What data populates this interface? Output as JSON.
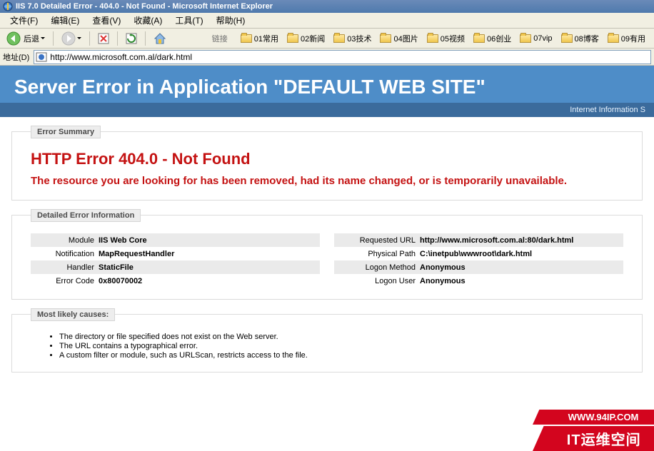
{
  "titlebar": {
    "text": "IIS 7.0 Detailed Error - 404.0 - Not Found - Microsoft Internet Explorer"
  },
  "menu": {
    "file": "文件(F)",
    "edit": "编辑(E)",
    "view": "查看(V)",
    "favorites": "收藏(A)",
    "tools": "工具(T)",
    "help": "帮助(H)"
  },
  "toolbar": {
    "back": "后退"
  },
  "linksbar": {
    "label": "链接",
    "items": [
      "01常用",
      "02新闻",
      "03技术",
      "04图片",
      "05视频",
      "06创业",
      "07vip",
      "08博客",
      "09有用"
    ]
  },
  "addressbar": {
    "label": "地址(D)",
    "url": "http://www.microsoft.com.al/dark.html"
  },
  "hero": {
    "title": "Server Error in Application \"DEFAULT WEB SITE\"",
    "sub": "Internet Information S"
  },
  "error_summary": {
    "legend": "Error Summary",
    "title": "HTTP Error 404.0 - Not Found",
    "desc": "The resource you are looking for has been removed, had its name changed, or is temporarily unavailable."
  },
  "details": {
    "legend": "Detailed Error Information",
    "left": {
      "module_l": "Module",
      "module_v": "IIS Web Core",
      "notif_l": "Notification",
      "notif_v": "MapRequestHandler",
      "handler_l": "Handler",
      "handler_v": "StaticFile",
      "code_l": "Error Code",
      "code_v": "0x80070002"
    },
    "right": {
      "requrl_l": "Requested URL",
      "requrl_v": "http://www.microsoft.com.al:80/dark.html",
      "phys_l": "Physical Path",
      "phys_v": "C:\\inetpub\\wwwroot\\dark.html",
      "logonm_l": "Logon Method",
      "logonm_v": "Anonymous",
      "logonu_l": "Logon User",
      "logonu_v": "Anonymous"
    }
  },
  "causes": {
    "legend": "Most likely causes:",
    "items": [
      "The directory or file specified does not exist on the Web server.",
      "The URL contains a typographical error.",
      "A custom filter or module, such as URLScan, restricts access to the file."
    ]
  },
  "watermark": {
    "url": "WWW.94IP.COM",
    "text": "IT运维空间"
  }
}
